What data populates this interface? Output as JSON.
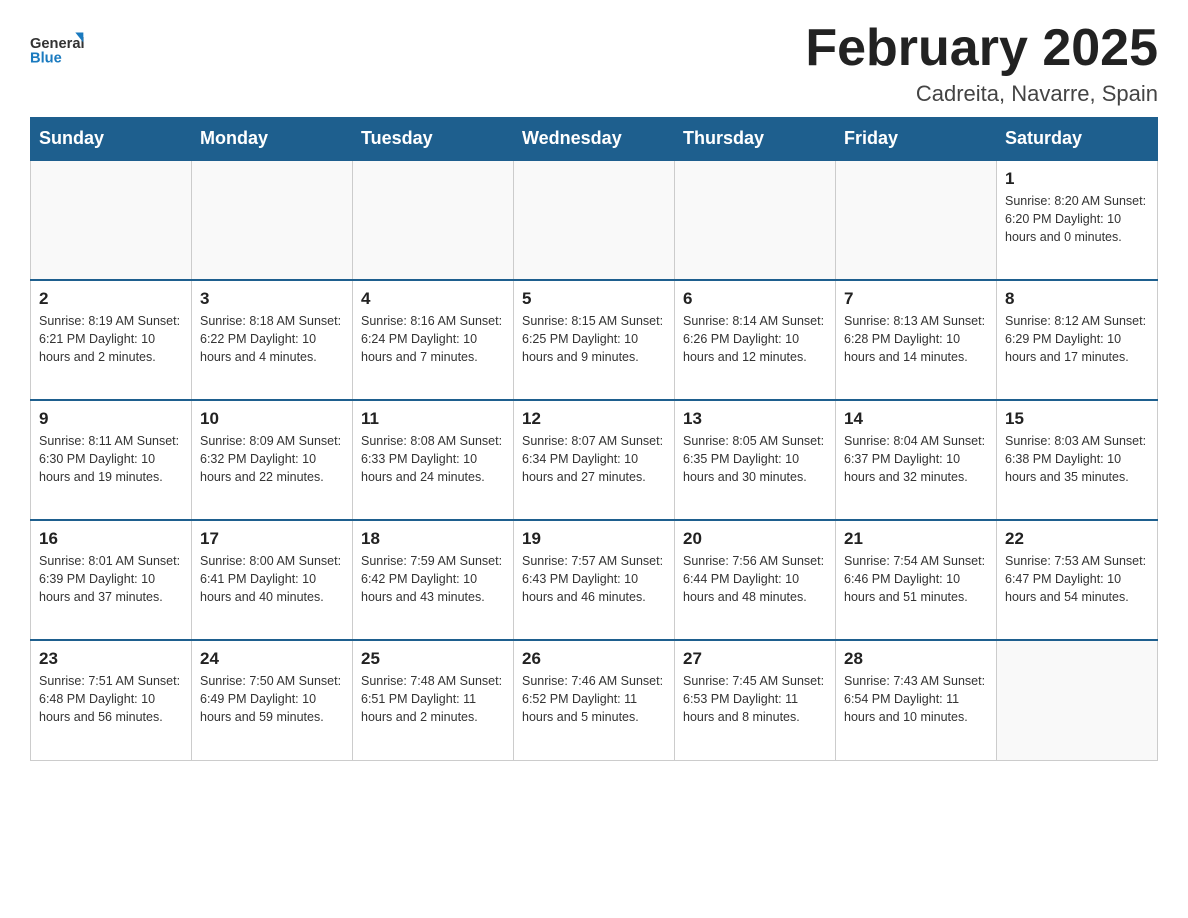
{
  "header": {
    "logo_general": "General",
    "logo_blue": "Blue",
    "title": "February 2025",
    "subtitle": "Cadreita, Navarre, Spain"
  },
  "days_of_week": [
    "Sunday",
    "Monday",
    "Tuesday",
    "Wednesday",
    "Thursday",
    "Friday",
    "Saturday"
  ],
  "weeks": [
    [
      {
        "day": "",
        "info": ""
      },
      {
        "day": "",
        "info": ""
      },
      {
        "day": "",
        "info": ""
      },
      {
        "day": "",
        "info": ""
      },
      {
        "day": "",
        "info": ""
      },
      {
        "day": "",
        "info": ""
      },
      {
        "day": "1",
        "info": "Sunrise: 8:20 AM\nSunset: 6:20 PM\nDaylight: 10 hours and 0 minutes."
      }
    ],
    [
      {
        "day": "2",
        "info": "Sunrise: 8:19 AM\nSunset: 6:21 PM\nDaylight: 10 hours and 2 minutes."
      },
      {
        "day": "3",
        "info": "Sunrise: 8:18 AM\nSunset: 6:22 PM\nDaylight: 10 hours and 4 minutes."
      },
      {
        "day": "4",
        "info": "Sunrise: 8:16 AM\nSunset: 6:24 PM\nDaylight: 10 hours and 7 minutes."
      },
      {
        "day": "5",
        "info": "Sunrise: 8:15 AM\nSunset: 6:25 PM\nDaylight: 10 hours and 9 minutes."
      },
      {
        "day": "6",
        "info": "Sunrise: 8:14 AM\nSunset: 6:26 PM\nDaylight: 10 hours and 12 minutes."
      },
      {
        "day": "7",
        "info": "Sunrise: 8:13 AM\nSunset: 6:28 PM\nDaylight: 10 hours and 14 minutes."
      },
      {
        "day": "8",
        "info": "Sunrise: 8:12 AM\nSunset: 6:29 PM\nDaylight: 10 hours and 17 minutes."
      }
    ],
    [
      {
        "day": "9",
        "info": "Sunrise: 8:11 AM\nSunset: 6:30 PM\nDaylight: 10 hours and 19 minutes."
      },
      {
        "day": "10",
        "info": "Sunrise: 8:09 AM\nSunset: 6:32 PM\nDaylight: 10 hours and 22 minutes."
      },
      {
        "day": "11",
        "info": "Sunrise: 8:08 AM\nSunset: 6:33 PM\nDaylight: 10 hours and 24 minutes."
      },
      {
        "day": "12",
        "info": "Sunrise: 8:07 AM\nSunset: 6:34 PM\nDaylight: 10 hours and 27 minutes."
      },
      {
        "day": "13",
        "info": "Sunrise: 8:05 AM\nSunset: 6:35 PM\nDaylight: 10 hours and 30 minutes."
      },
      {
        "day": "14",
        "info": "Sunrise: 8:04 AM\nSunset: 6:37 PM\nDaylight: 10 hours and 32 minutes."
      },
      {
        "day": "15",
        "info": "Sunrise: 8:03 AM\nSunset: 6:38 PM\nDaylight: 10 hours and 35 minutes."
      }
    ],
    [
      {
        "day": "16",
        "info": "Sunrise: 8:01 AM\nSunset: 6:39 PM\nDaylight: 10 hours and 37 minutes."
      },
      {
        "day": "17",
        "info": "Sunrise: 8:00 AM\nSunset: 6:41 PM\nDaylight: 10 hours and 40 minutes."
      },
      {
        "day": "18",
        "info": "Sunrise: 7:59 AM\nSunset: 6:42 PM\nDaylight: 10 hours and 43 minutes."
      },
      {
        "day": "19",
        "info": "Sunrise: 7:57 AM\nSunset: 6:43 PM\nDaylight: 10 hours and 46 minutes."
      },
      {
        "day": "20",
        "info": "Sunrise: 7:56 AM\nSunset: 6:44 PM\nDaylight: 10 hours and 48 minutes."
      },
      {
        "day": "21",
        "info": "Sunrise: 7:54 AM\nSunset: 6:46 PM\nDaylight: 10 hours and 51 minutes."
      },
      {
        "day": "22",
        "info": "Sunrise: 7:53 AM\nSunset: 6:47 PM\nDaylight: 10 hours and 54 minutes."
      }
    ],
    [
      {
        "day": "23",
        "info": "Sunrise: 7:51 AM\nSunset: 6:48 PM\nDaylight: 10 hours and 56 minutes."
      },
      {
        "day": "24",
        "info": "Sunrise: 7:50 AM\nSunset: 6:49 PM\nDaylight: 10 hours and 59 minutes."
      },
      {
        "day": "25",
        "info": "Sunrise: 7:48 AM\nSunset: 6:51 PM\nDaylight: 11 hours and 2 minutes."
      },
      {
        "day": "26",
        "info": "Sunrise: 7:46 AM\nSunset: 6:52 PM\nDaylight: 11 hours and 5 minutes."
      },
      {
        "day": "27",
        "info": "Sunrise: 7:45 AM\nSunset: 6:53 PM\nDaylight: 11 hours and 8 minutes."
      },
      {
        "day": "28",
        "info": "Sunrise: 7:43 AM\nSunset: 6:54 PM\nDaylight: 11 hours and 10 minutes."
      },
      {
        "day": "",
        "info": ""
      }
    ]
  ]
}
